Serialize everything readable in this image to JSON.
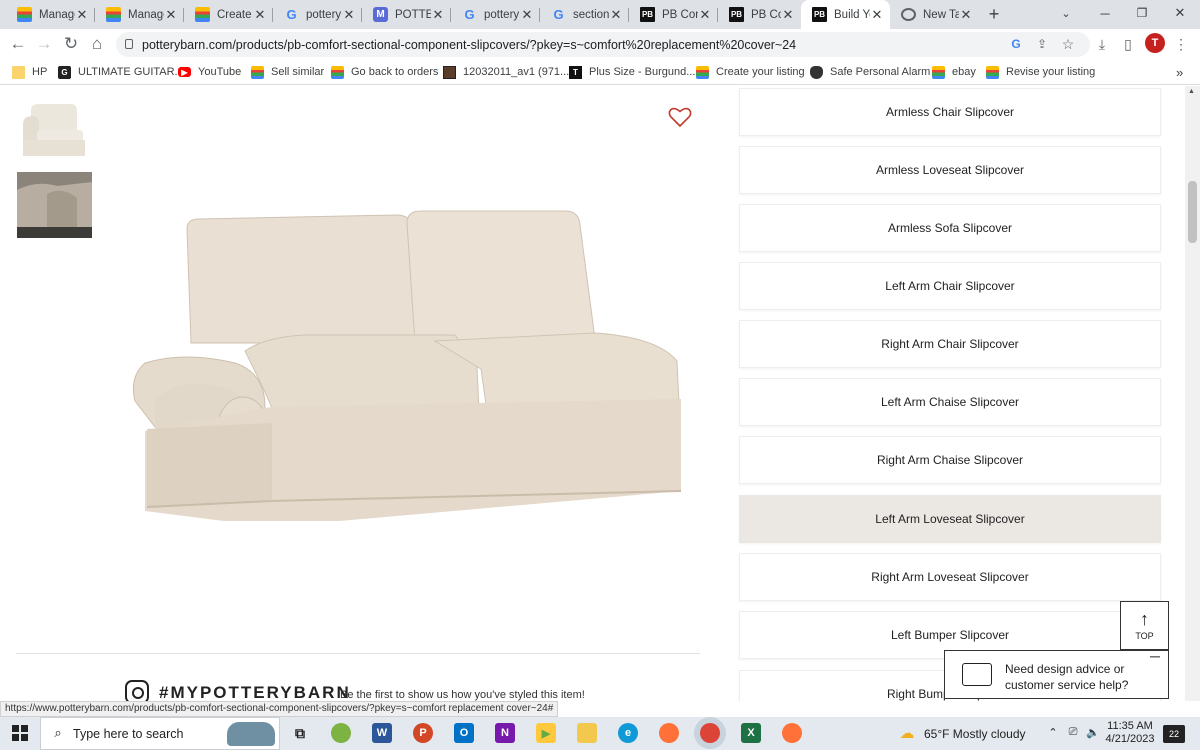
{
  "browser": {
    "tabs": [
      {
        "title": "Manage",
        "icon": "shopping-bag-icon",
        "active": false
      },
      {
        "title": "Manage",
        "icon": "shopping-bag-icon",
        "active": false
      },
      {
        "title": "Create y",
        "icon": "shopping-bag-icon",
        "active": false
      },
      {
        "title": "pottery",
        "icon": "google-icon",
        "active": false
      },
      {
        "title": "POTTER",
        "icon": "m-app-icon",
        "active": false
      },
      {
        "title": "pottery",
        "icon": "google-icon",
        "active": false
      },
      {
        "title": "sectiona",
        "icon": "google-icon",
        "active": false
      },
      {
        "title": "PB Com",
        "icon": "pb-icon",
        "active": false
      },
      {
        "title": "PB Com",
        "icon": "pb-icon",
        "active": false
      },
      {
        "title": "Build Yo",
        "icon": "pb-icon",
        "active": true
      },
      {
        "title": "New Tab",
        "icon": "new-tab-icon",
        "active": false
      }
    ],
    "new_tab_symbol": "+",
    "url": "potterybarn.com/products/pb-comfort-sectional-component-slipcovers/?pkey=s~comfort%20replacement%20cover~24",
    "profile_initial": "T",
    "bookmarks": [
      {
        "label": "HP",
        "icon": "folder-icon"
      },
      {
        "label": "ULTIMATE GUITAR...",
        "icon": "ultimate-guitar-icon"
      },
      {
        "label": "YouTube",
        "icon": "youtube-icon"
      },
      {
        "label": "Sell similar",
        "icon": "shopping-bag-icon"
      },
      {
        "label": "Go back to orders",
        "icon": "shopping-bag-icon"
      },
      {
        "label": "12032011_av1 (971...",
        "icon": "image-icon"
      },
      {
        "label": "Plus Size - Burgund...",
        "icon": "t-icon"
      },
      {
        "label": "Create your listing",
        "icon": "shopping-bag-icon"
      },
      {
        "label": "Safe Personal Alarm",
        "icon": "shield-icon"
      },
      {
        "label": "ebay",
        "icon": "shopping-bag-icon"
      },
      {
        "label": "Revise your listing",
        "icon": "shopping-bag-icon"
      }
    ],
    "bookmarks_more": "»",
    "status_url": "https://www.potterybarn.com/products/pb-comfort-sectional-component-slipcovers/?pkey=s~comfort replacement cover~24#"
  },
  "page": {
    "options": [
      {
        "label": "Armless Chair Slipcover",
        "selected": false
      },
      {
        "label": "Armless Loveseat Slipcover",
        "selected": false
      },
      {
        "label": "Armless Sofa Slipcover",
        "selected": false
      },
      {
        "label": "Left Arm Chair Slipcover",
        "selected": false
      },
      {
        "label": "Right Arm Chair Slipcover",
        "selected": false
      },
      {
        "label": "Left Arm Chaise Slipcover",
        "selected": false
      },
      {
        "label": "Right Arm Chaise Slipcover",
        "selected": false
      },
      {
        "label": "Left Arm Loveseat Slipcover",
        "selected": true
      },
      {
        "label": "Right Arm Loveseat Slipcover",
        "selected": false
      },
      {
        "label": "Left Bumper Slipcover",
        "selected": false
      },
      {
        "label": "Right Bumper Slipcover",
        "selected": false
      }
    ],
    "hashtag": "#MYPOTTERYBARN",
    "hashtag_sub": "Be the first to show us how you've styled this item!",
    "top_label": "TOP",
    "chat_text": "Need design advice or customer service help?",
    "colors": {
      "selected_option": "#ebe8e4",
      "heart": "#c0392b",
      "fabric": "#e8dfd2"
    }
  },
  "taskbar": {
    "search_placeholder": "Type here to search",
    "weather": "65°F  Mostly cloudy",
    "time": "11:35 AM",
    "date": "4/21/2023",
    "notifications": "22"
  }
}
